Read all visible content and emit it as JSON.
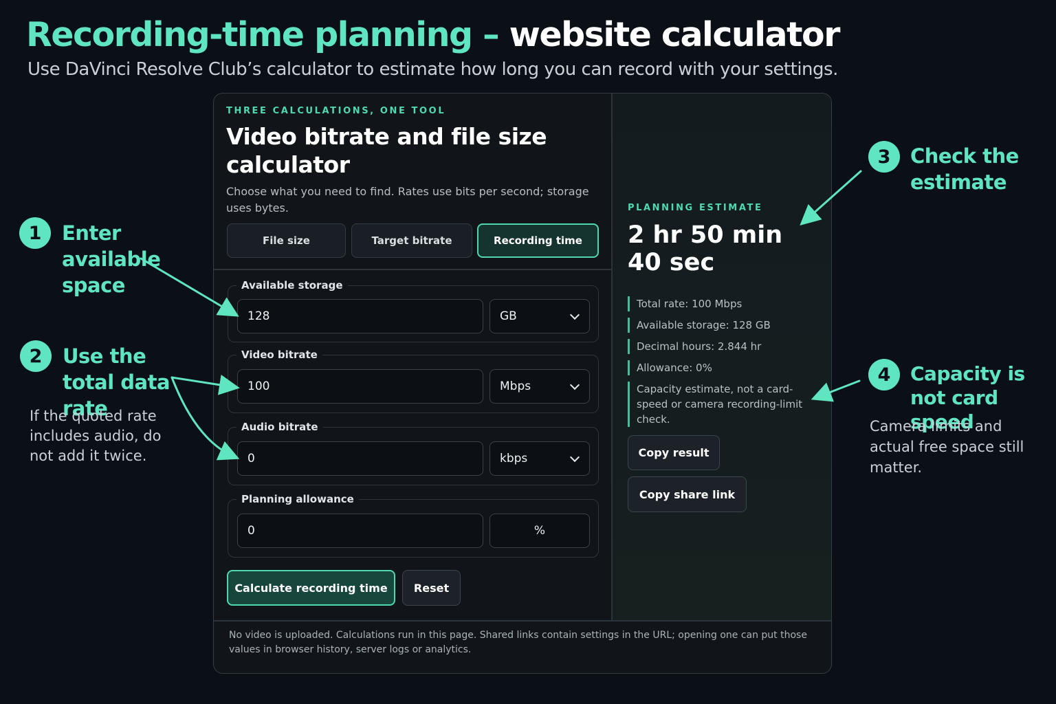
{
  "header": {
    "title_accent": "Recording-time planning –",
    "title_rest": "website calculator",
    "subtitle": "Use DaVinci Resolve Club’s calculator to estimate how long you can record with your settings."
  },
  "calculator": {
    "eyebrow": "THREE CALCULATIONS, ONE TOOL",
    "title": "Video bitrate and file size calculator",
    "description": "Choose what you need to find. Rates use bits per second; storage uses bytes.",
    "tabs": [
      {
        "label": "File size",
        "active": false
      },
      {
        "label": "Target bitrate",
        "active": false
      },
      {
        "label": "Recording time",
        "active": true
      }
    ],
    "fields": {
      "storage": {
        "label": "Available storage",
        "value": "128",
        "unit": "GB"
      },
      "video": {
        "label": "Video bitrate",
        "value": "100",
        "unit": "Mbps"
      },
      "audio": {
        "label": "Audio bitrate",
        "value": "0",
        "unit": "kbps"
      },
      "allowance": {
        "label": "Planning allowance",
        "value": "0",
        "unit": "%"
      }
    },
    "buttons": {
      "calculate": "Calculate recording time",
      "reset": "Reset"
    },
    "footnote": "No video is uploaded. Calculations run in this page. Shared links contain settings in the URL; opening one can put those values in browser history, server logs or analytics."
  },
  "result": {
    "eyebrow": "PLANNING ESTIMATE",
    "estimate": "2 hr 50 min 40 sec",
    "details": [
      "Total rate: 100 Mbps",
      "Available storage: 128 GB",
      "Decimal hours: 2.844 hr",
      "Allowance: 0%",
      "Capacity estimate, not a card-speed or camera recording-limit check."
    ],
    "copy_result": "Copy result",
    "copy_link": "Copy share link"
  },
  "annotations": {
    "step1": {
      "number": "1",
      "label": "Enter available space"
    },
    "step2": {
      "number": "2",
      "label": "Use the total data rate",
      "note": "If the quoted rate includes audio, do not add it twice."
    },
    "step3": {
      "number": "3",
      "label": "Check the estimate"
    },
    "step4": {
      "number": "4",
      "label": "Capacity is not card speed",
      "note": "Camera limits and actual free space still matter."
    }
  },
  "colors": {
    "accent": "#5fe6c0",
    "background": "#0b1016"
  }
}
